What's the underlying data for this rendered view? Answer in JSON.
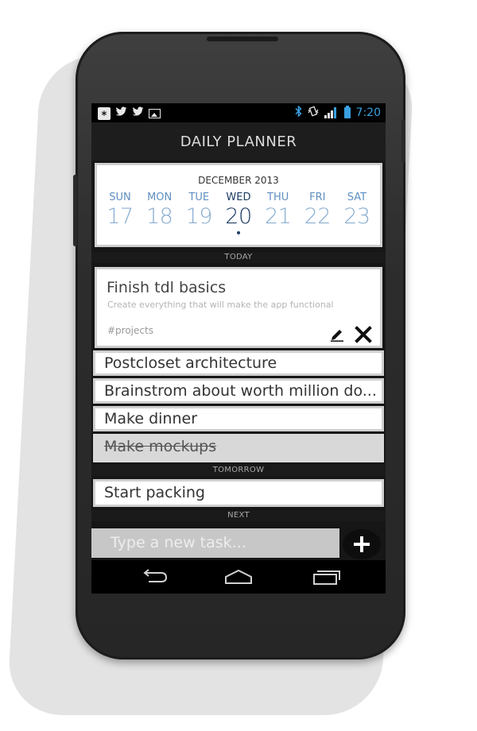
{
  "status_bar": {
    "left_icons": [
      "bluetooth-notification-icon",
      "twitter-icon",
      "twitter-icon",
      "image-icon"
    ],
    "right_icons": [
      "bluetooth-icon",
      "vibrate-icon",
      "signal-icon",
      "battery-icon"
    ],
    "time": "7:20",
    "accent_color": "#3aa0e0"
  },
  "app": {
    "title": "DAILY PLANNER"
  },
  "calendar": {
    "month": "DECEMBER 2013",
    "days": [
      {
        "name": "SUN",
        "date": "17"
      },
      {
        "name": "MON",
        "date": "18"
      },
      {
        "name": "TUE",
        "date": "19"
      },
      {
        "name": "WED",
        "date": "20",
        "selected": true
      },
      {
        "name": "THU",
        "date": "21"
      },
      {
        "name": "FRI",
        "date": "22"
      },
      {
        "name": "SAT",
        "date": "23"
      }
    ],
    "day_color": "#8aaed1",
    "selected_color": "#1e3e64"
  },
  "sections": {
    "today": "TODAY",
    "tomorrow": "TOMORROW",
    "next": "NEXT"
  },
  "expanded_task": {
    "title": "Finish tdl basics",
    "description": "Create everything that will make the app functional",
    "tag": "#projects",
    "edit_icon": "pencil-icon",
    "delete_icon": "close-icon"
  },
  "today_tasks": [
    {
      "title": "Postcloset architecture",
      "done": false
    },
    {
      "title": "Brainstrom about worth million do...",
      "done": false
    },
    {
      "title": "Make dinner",
      "done": false
    },
    {
      "title": "Make mockups",
      "done": true
    }
  ],
  "tomorrow_tasks": [
    {
      "title": "Start packing",
      "done": false
    }
  ],
  "new_task": {
    "placeholder": "Type a new task...",
    "add_icon": "plus-icon"
  },
  "nav": {
    "icons": [
      "back-icon",
      "home-icon",
      "recent-apps-icon"
    ]
  }
}
